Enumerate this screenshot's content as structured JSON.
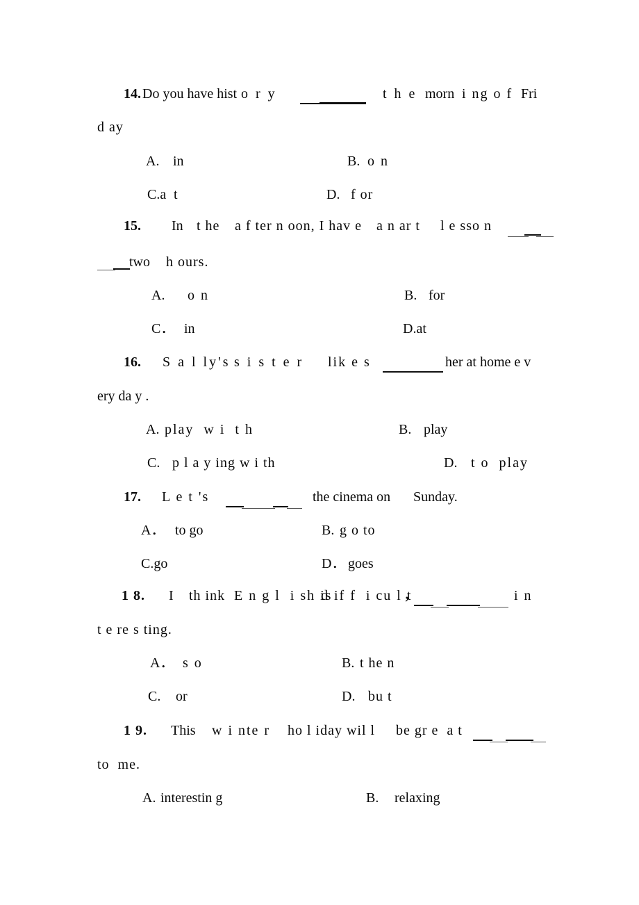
{
  "document": {
    "type": "multiple-choice-worksheet",
    "page_background": "#ffffff",
    "text_color": "#0a0a0a"
  },
  "questions": [
    {
      "number": "14.",
      "stem_line1_a": "Do you have hist",
      "stem_line1_b": "o r y",
      "stem_line1_c": "t h e",
      "stem_line1_d": "morn",
      "stem_line1_e": "i ng o f",
      "stem_line1_f": "Fri",
      "stem_line2": "d ay",
      "option_a_label": "A.",
      "option_a_text": "in",
      "option_b_label": "B.",
      "option_b_text": "o n",
      "option_c_label": "C.a",
      "option_c_text": "t",
      "option_d_label": "D.",
      "option_d_text": "f or"
    },
    {
      "number": "15.",
      "stem_line1_a": "In",
      "stem_line1_b": "t he",
      "stem_line1_c": "a f ter n oon, I hav e",
      "stem_line1_d": "a n ar t",
      "stem_line1_e": "l e sso n",
      "stem_line2": "two",
      "stem_line2_b": "h ours.",
      "option_a_label": "A.",
      "option_a_text": "o n",
      "option_b_label": "B.",
      "option_b_text": "for",
      "option_c_label": "C．",
      "option_c_text": "in",
      "option_d_label": "D.at",
      "option_d_text": ""
    },
    {
      "number": "16.",
      "stem_line1_a": "S a l ly's",
      "stem_line1_b": "s i s t e r",
      "stem_line1_c": "lik e s",
      "stem_line1_d": "her at home e v",
      "stem_line2": "ery da y .",
      "option_a_label": "A.",
      "option_a_text": "play  w i  t h",
      "option_b_label": "B.",
      "option_b_text": "play",
      "option_c_label": "C.",
      "option_c_text": "p l a y ing w i th",
      "option_d_label": "D.",
      "option_d_text": "t o  play"
    },
    {
      "number": "17.",
      "stem_line1_a": "L e t 's",
      "stem_line1_b": "the cinema on",
      "stem_line1_c": "Sunday.",
      "option_a_label": "A．",
      "option_a_text": "to go",
      "option_b_label": "B.",
      "option_b_text": "g o to",
      "option_c_label": "C.go",
      "option_c_text": "",
      "option_d_label": "D．",
      "option_d_text": "goes"
    },
    {
      "number": "1 8.",
      "stem_line1_a": "I",
      "stem_line1_b": "th ink",
      "stem_line1_c": "E n g l  i sh is",
      "stem_line1_d": "d if f  i cu l t",
      "stem_line1_comma": "，",
      "stem_line1_e": "i n",
      "stem_line2": "t e re s ting.",
      "option_a_label": "A．",
      "option_a_text": "s o",
      "option_b_label": "B.",
      "option_b_text": "t he n",
      "option_c_label": "C.",
      "option_c_text": "or",
      "option_d_label": "D.",
      "option_d_text": "bu t"
    },
    {
      "number": "1 9.",
      "stem_line1_a": "This",
      "stem_line1_b": "w i nte r",
      "stem_line1_c": "ho l iday wil l",
      "stem_line1_d": "be gr e  a t",
      "stem_line2": "to  me.",
      "option_a_label": "A.",
      "option_a_text": "interestin g",
      "option_b_label": "B.",
      "option_b_text": "relaxing"
    }
  ]
}
